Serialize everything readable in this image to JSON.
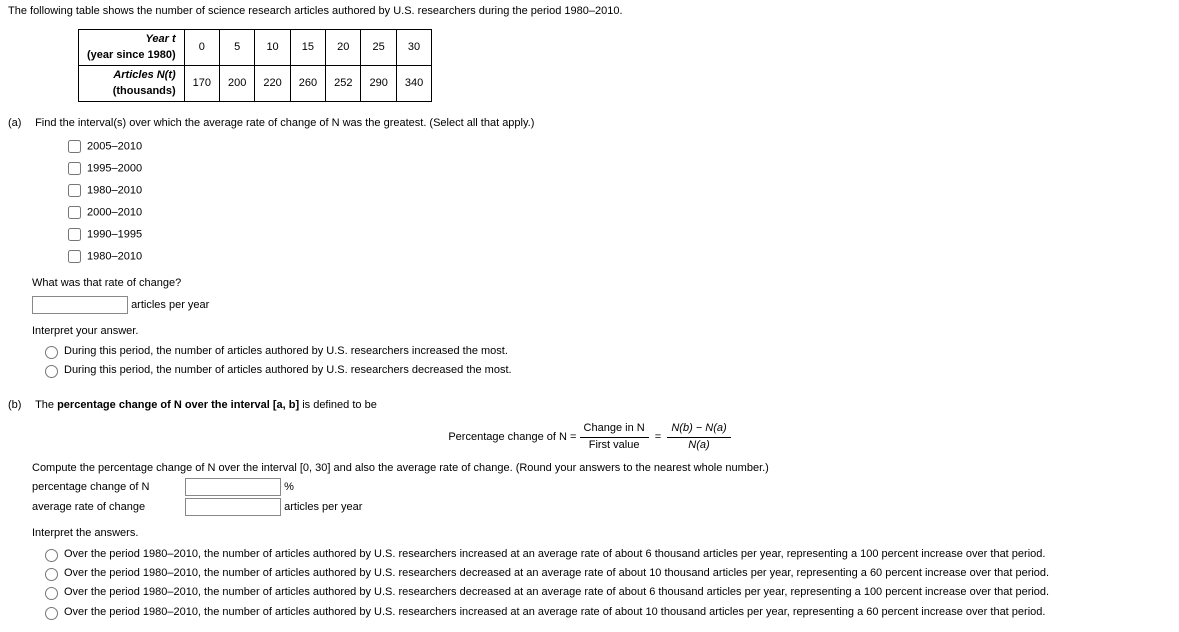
{
  "intro": "The following table shows the number of science research articles authored by U.S. researchers during the period 1980–2010.",
  "table": {
    "row1_label_a": "Year t",
    "row1_label_b": "(year since 1980)",
    "row2_label_a": "Articles N(t)",
    "row2_label_b": "(thousands)",
    "years": [
      "0",
      "5",
      "10",
      "15",
      "20",
      "25",
      "30"
    ],
    "values": [
      "170",
      "200",
      "220",
      "260",
      "252",
      "290",
      "340"
    ]
  },
  "partA": {
    "marker": "(a)",
    "question": "Find the interval(s) over which the average rate of change of N was the greatest. (Select all that apply.)",
    "options": [
      "2005–2010",
      "1995–2000",
      "1980–2010",
      "2000–2010",
      "1990–1995",
      "1980–2010"
    ],
    "rateQ": "What was that rate of change?",
    "rateUnit": "articles per year",
    "interpretHead": "Interpret your answer.",
    "interpret": [
      "During this period, the number of articles authored by U.S. researchers increased the most.",
      "During this period, the number of articles authored by U.S. researchers decreased the most."
    ]
  },
  "partB": {
    "marker": "(b)",
    "lead_a": "The ",
    "lead_b": "percentage change of N over the interval [a, b]",
    "lead_c": " is defined to be",
    "formula_lhs": "Percentage change of N = ",
    "formula_num1": "Change in N",
    "formula_den1": "First value",
    "formula_num2": "N(b) − N(a)",
    "formula_den2": "N(a)",
    "computeQ": "Compute the percentage change of N over the interval [0, 30] and also the average rate of change. (Round your answers to the nearest whole number.)",
    "pcLabel": "percentage change of N",
    "pcUnit": "%",
    "arcLabel": "average rate of change",
    "arcUnit": "articles per year",
    "interpretHead": "Interpret the answers.",
    "interpret": [
      "Over the period 1980–2010, the number of articles authored by U.S. researchers increased at an average rate of about 6 thousand articles per year, representing a 100 percent increase over that period.",
      "Over the period 1980–2010, the number of articles authored by U.S. researchers decreased at an average rate of about 10 thousand articles per year, representing a 60 percent increase over that period.",
      "Over the period 1980–2010, the number of articles authored by U.S. researchers decreased at an average rate of about 6 thousand articles per year, representing a 100 percent increase over that period.",
      "Over the period 1980–2010, the number of articles authored by U.S. researchers increased at an average rate of about 10 thousand articles per year, representing a 60 percent increase over that period."
    ]
  }
}
